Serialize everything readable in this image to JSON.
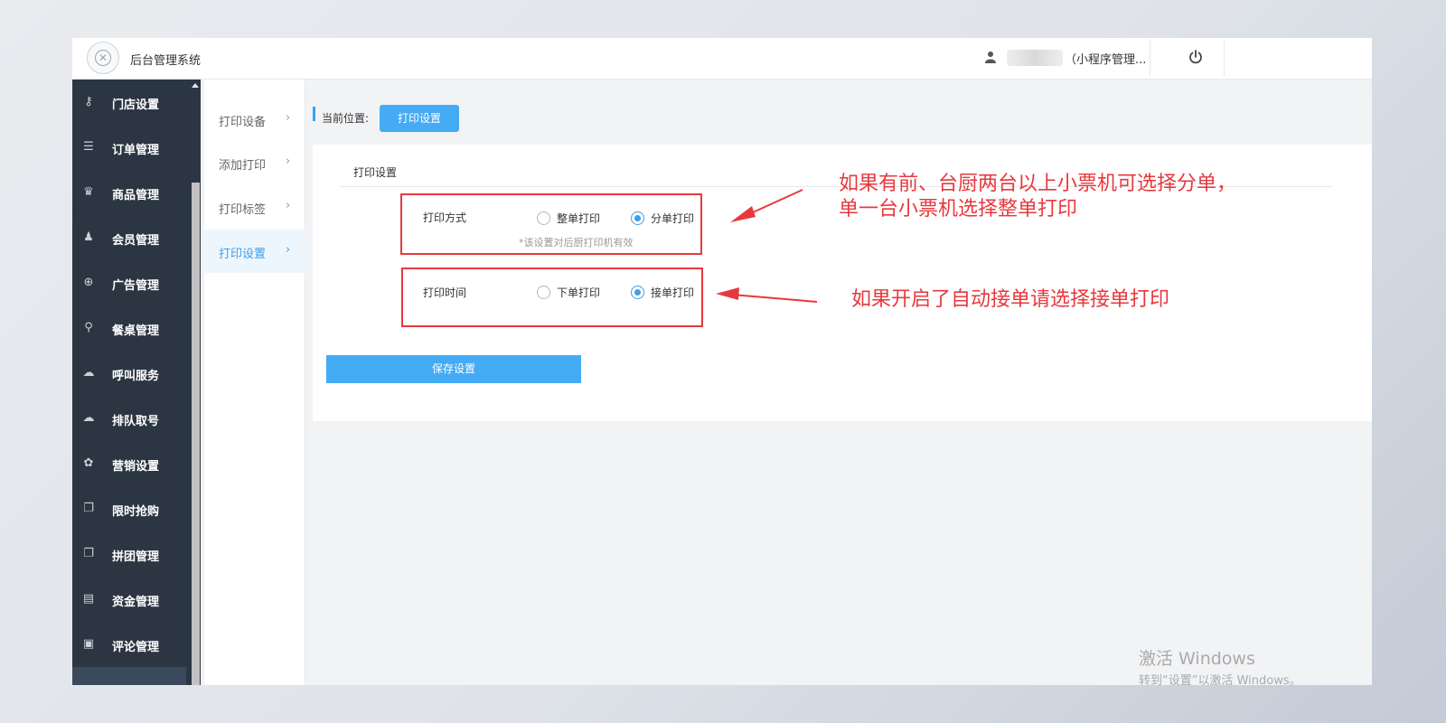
{
  "header": {
    "app_title": "后台管理系统",
    "user_name": "（小程序管理...",
    "icons": [
      "user-icon",
      "power-icon"
    ]
  },
  "sidebar": {
    "items": [
      {
        "label": "门店设置",
        "icon": "key-icon",
        "glyph": "⚷"
      },
      {
        "label": "订单管理",
        "icon": "list-icon",
        "glyph": "☰"
      },
      {
        "label": "商品管理",
        "icon": "trophy-icon",
        "glyph": "♛"
      },
      {
        "label": "会员管理",
        "icon": "user-icon",
        "glyph": "♟"
      },
      {
        "label": "广告管理",
        "icon": "lifebuoy-icon",
        "glyph": "⊕"
      },
      {
        "label": "餐桌管理",
        "icon": "binoculars-icon",
        "glyph": "⚲"
      },
      {
        "label": "呼叫服务",
        "icon": "cloud-icon",
        "glyph": "☁"
      },
      {
        "label": "排队取号",
        "icon": "cloud-icon",
        "glyph": "☁"
      },
      {
        "label": "营销设置",
        "icon": "gift-icon",
        "glyph": "✿"
      },
      {
        "label": "限时抢购",
        "icon": "copy-icon",
        "glyph": "❐"
      },
      {
        "label": "拼团管理",
        "icon": "copy-icon",
        "glyph": "❐"
      },
      {
        "label": "资金管理",
        "icon": "book-icon",
        "glyph": "▤"
      },
      {
        "label": "评论管理",
        "icon": "money-icon",
        "glyph": "▣"
      }
    ]
  },
  "submenu": {
    "items": [
      {
        "label": "打印设备",
        "active": false
      },
      {
        "label": "添加打印",
        "active": false
      },
      {
        "label": "打印标签",
        "active": false
      },
      {
        "label": "打印设置",
        "active": true
      }
    ],
    "chevron": "›"
  },
  "breadcrumb": {
    "label": "当前位置:",
    "current": "打印设置"
  },
  "panel": {
    "title": "打印设置",
    "print_mode": {
      "label": "打印方式",
      "options": [
        "整单打印",
        "分单打印"
      ],
      "selected": "分单打印",
      "hint": "*该设置对后厨打印机有效"
    },
    "print_time": {
      "label": "打印时间",
      "options": [
        "下单打印",
        "接单打印"
      ],
      "selected": "接单打印"
    },
    "save_label": "保存设置"
  },
  "annotations": {
    "note1_line1": "如果有前、台厨两台以上小票机可选择分单，",
    "note1_line2": "单一台小票机选择整单打印",
    "note2": "如果开启了自动接单请选择接单打印",
    "color": "#e8383d"
  },
  "watermark": {
    "line1": "激活 Windows",
    "line2": "转到“设置”以激活 Windows。"
  }
}
